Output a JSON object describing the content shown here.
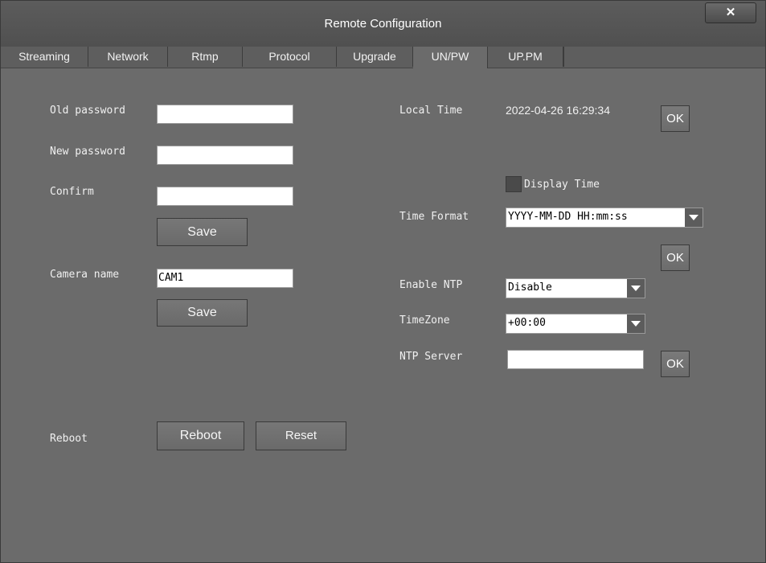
{
  "window": {
    "title": "Remote Configuration",
    "close_label": "✕"
  },
  "tabs": [
    {
      "label": "Streaming",
      "active": false
    },
    {
      "label": "Network",
      "active": false
    },
    {
      "label": "Rtmp",
      "active": false
    },
    {
      "label": "Protocol",
      "active": false
    },
    {
      "label": "Upgrade",
      "active": false
    },
    {
      "label": "UN/PW",
      "active": true
    },
    {
      "label": "UP.PM",
      "active": false
    }
  ],
  "password": {
    "old_label": "Old password",
    "old_value": "",
    "new_label": "New password",
    "new_value": "",
    "confirm_label": "Confirm",
    "confirm_value": "",
    "save_label": "Save"
  },
  "camera": {
    "name_label": "Camera name",
    "name_value": "CAM1",
    "save_label": "Save"
  },
  "reboot": {
    "label": "Reboot",
    "reboot_label": "Reboot",
    "reset_label": "Reset"
  },
  "time": {
    "local_time_label": "Local Time",
    "local_time_value": "2022-04-26 16:29:34",
    "ok_label": "OK",
    "display_time_label": "Display Time",
    "display_time_checked": false,
    "format_label": "Time Format",
    "format_value": "YYYY-MM-DD HH:mm:ss",
    "format_ok_label": "OK",
    "ntp_label": "Enable NTP",
    "ntp_value": "Disable",
    "timezone_label": "TimeZone",
    "timezone_value": "+00:00",
    "ntp_server_label": "NTP Server",
    "ntp_server_value": "",
    "ntp_ok_label": "OK"
  }
}
